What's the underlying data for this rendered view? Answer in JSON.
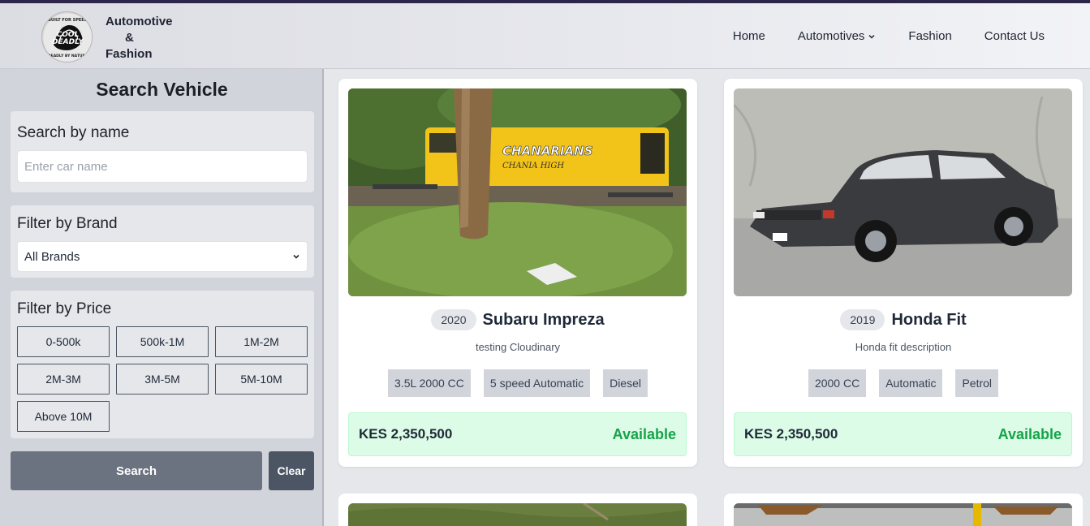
{
  "header": {
    "brand_line1": "Automotive",
    "brand_line2": "&",
    "brand_line3": "Fashion",
    "logo_text": {
      "top": "BUILT FOR SPEED",
      "main1": "COOL",
      "main2": "DEADLY",
      "bottom": "DEADLY BY NATURE"
    },
    "nav": [
      {
        "label": "Home"
      },
      {
        "label": "Automotives",
        "icon": "chevron-down-icon"
      },
      {
        "label": "Fashion"
      },
      {
        "label": "Contact Us"
      }
    ]
  },
  "sidebar": {
    "title": "Search Vehicle",
    "search_label": "Search by name",
    "search_placeholder": "Enter car name",
    "search_value": "",
    "brand_label": "Filter by Brand",
    "brand_selected": "All Brands",
    "price_label": "Filter by Price",
    "price_ranges": [
      "0-500k",
      "500k-1M",
      "1M-2M",
      "2M-3M",
      "3M-5M",
      "5M-10M",
      "Above 10M"
    ],
    "search_button": "Search",
    "clear_button": "Clear"
  },
  "listings": [
    {
      "year": "2020",
      "name": "Subaru Impreza",
      "description": "testing Cloudinary",
      "specs": [
        "3.5L 2000 CC",
        "5 speed Automatic",
        "Diesel"
      ],
      "price": "KES 2,350,500",
      "status": "Available",
      "image_text": {
        "line1": "CHANARIANS",
        "line2": "CHANIA HIGH"
      }
    },
    {
      "year": "2019",
      "name": "Honda Fit",
      "description": "Honda fit description",
      "specs": [
        "2000 CC",
        "Automatic",
        "Petrol"
      ],
      "price": "KES 2,350,500",
      "status": "Available"
    }
  ],
  "colors": {
    "accent_top": "#2e2648",
    "available_green": "#16a34a",
    "price_bg": "#dcfce7",
    "search_button": "#6b7280",
    "clear_button": "#4b5563"
  }
}
